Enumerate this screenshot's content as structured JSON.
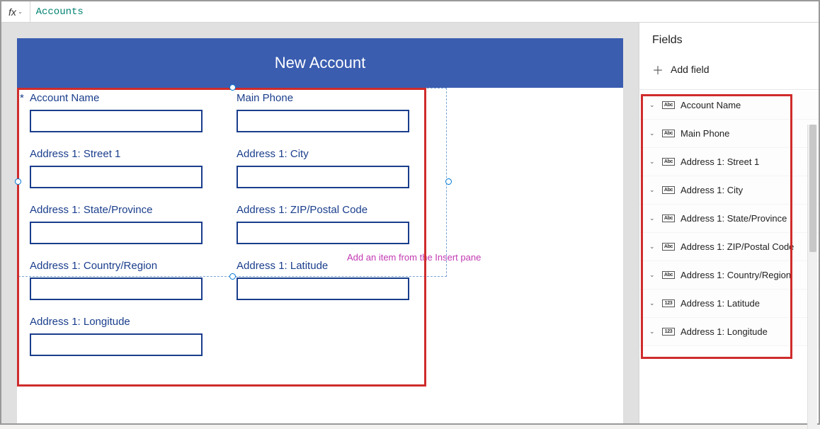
{
  "formula_bar": {
    "fx_label": "fx",
    "value": "Accounts"
  },
  "canvas": {
    "title": "New Account",
    "placeholder_hint": "Add an item from the Insert pane",
    "fields": [
      {
        "label": "Account Name",
        "required": true
      },
      {
        "label": "Main Phone",
        "required": false
      },
      {
        "label": "Address 1: Street 1",
        "required": false
      },
      {
        "label": "Address 1: City",
        "required": false
      },
      {
        "label": "Address 1: State/Province",
        "required": false
      },
      {
        "label": "Address 1: ZIP/Postal Code",
        "required": false
      },
      {
        "label": "Address 1: Country/Region",
        "required": false
      },
      {
        "label": "Address 1: Latitude",
        "required": false
      },
      {
        "label": "Address 1: Longitude",
        "required": false
      }
    ]
  },
  "fields_panel": {
    "title": "Fields",
    "add_field_label": "Add field",
    "items": [
      {
        "type": "Abc",
        "label": "Account Name"
      },
      {
        "type": "Abc",
        "label": "Main Phone"
      },
      {
        "type": "Abc",
        "label": "Address 1: Street 1"
      },
      {
        "type": "Abc",
        "label": "Address 1: City"
      },
      {
        "type": "Abc",
        "label": "Address 1: State/Province"
      },
      {
        "type": "Abc",
        "label": "Address 1: ZIP/Postal Code"
      },
      {
        "type": "Abc",
        "label": "Address 1: Country/Region"
      },
      {
        "type": "123",
        "label": "Address 1: Latitude"
      },
      {
        "type": "123",
        "label": "Address 1: Longitude"
      }
    ]
  }
}
